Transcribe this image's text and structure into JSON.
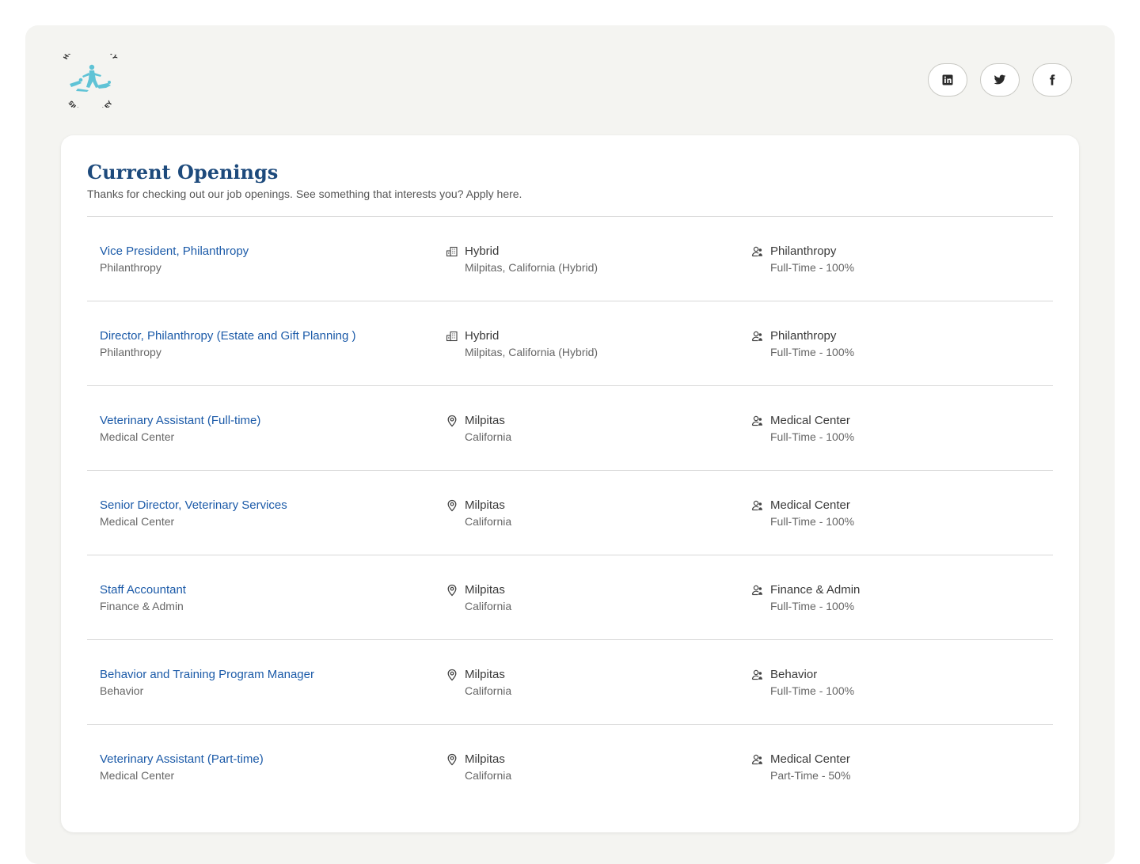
{
  "org": {
    "logo_text_top": "HUMANE SOCIETY",
    "logo_text_bottom": "SILICON VALLEY"
  },
  "socials": [
    {
      "name": "linkedin",
      "icon": "linkedin-icon"
    },
    {
      "name": "twitter",
      "icon": "twitter-icon"
    },
    {
      "name": "facebook",
      "icon": "facebook-icon"
    }
  ],
  "main": {
    "title": "Current Openings",
    "subtitle": "Thanks for checking out our job openings. See something that interests you? Apply here."
  },
  "jobs": [
    {
      "title": "Vice President, Philanthropy",
      "department": "Philanthropy",
      "location_type": "hybrid",
      "location_main": "Hybrid",
      "location_sub": "Milpitas, California (Hybrid)",
      "team": "Philanthropy",
      "employment": "Full-Time - 100%"
    },
    {
      "title": "Director, Philanthropy (Estate and Gift Planning )",
      "department": "Philanthropy",
      "location_type": "hybrid",
      "location_main": "Hybrid",
      "location_sub": "Milpitas, California (Hybrid)",
      "team": "Philanthropy",
      "employment": "Full-Time - 100%"
    },
    {
      "title": "Veterinary Assistant (Full-time)",
      "department": "Medical Center",
      "location_type": "onsite",
      "location_main": "Milpitas",
      "location_sub": "California",
      "team": "Medical Center",
      "employment": "Full-Time - 100%"
    },
    {
      "title": "Senior Director, Veterinary Services",
      "department": "Medical Center",
      "location_type": "onsite",
      "location_main": "Milpitas",
      "location_sub": "California",
      "team": "Medical Center",
      "employment": "Full-Time - 100%"
    },
    {
      "title": "Staff Accountant",
      "department": "Finance & Admin",
      "location_type": "onsite",
      "location_main": "Milpitas",
      "location_sub": "California",
      "team": "Finance & Admin",
      "employment": "Full-Time - 100%"
    },
    {
      "title": "Behavior and Training Program Manager",
      "department": "Behavior",
      "location_type": "onsite",
      "location_main": "Milpitas",
      "location_sub": "California",
      "team": "Behavior",
      "employment": "Full-Time - 100%"
    },
    {
      "title": "Veterinary Assistant (Part-time)",
      "department": "Medical Center",
      "location_type": "onsite",
      "location_main": "Milpitas",
      "location_sub": "California",
      "team": "Medical Center",
      "employment": "Part-Time - 50%"
    }
  ],
  "colors": {
    "accent": "#1b5aa8",
    "title": "#1d4a7c",
    "logo_teal": "#5fc3d6",
    "background": "#f4f4f1"
  }
}
